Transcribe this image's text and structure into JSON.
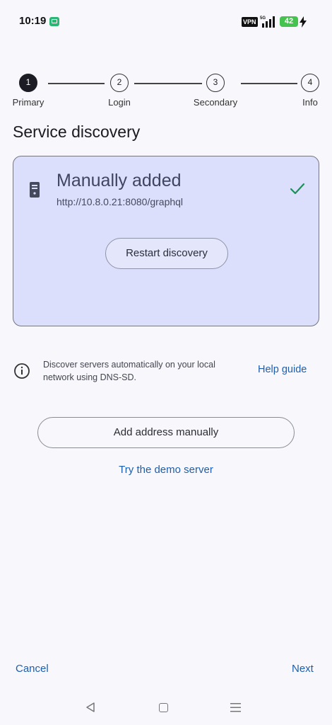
{
  "status_bar": {
    "time": "10:19",
    "app_icon": "screen-notification-icon",
    "vpn_label": "VPN",
    "network_label": "5G",
    "battery_level": "42",
    "charging_icon": "bolt-icon"
  },
  "stepper": {
    "steps": [
      {
        "number": "1",
        "label": "Primary",
        "active": true
      },
      {
        "number": "2",
        "label": "Login",
        "active": false
      },
      {
        "number": "3",
        "label": "Secondary",
        "active": false
      },
      {
        "number": "4",
        "label": "Info",
        "active": false
      }
    ]
  },
  "page": {
    "title": "Service discovery"
  },
  "server_card": {
    "icon": "server-icon",
    "name": "Manually added",
    "url": "http://10.8.0.21:8080/graphql",
    "selected_icon": "check-icon",
    "restart_label": "Restart discovery",
    "background_color": "#dcdffc"
  },
  "info": {
    "icon": "info-icon",
    "text": "Discover servers automatically on your local network using DNS-SD.",
    "help_label": "Help guide"
  },
  "actions": {
    "add_manual_label": "Add address manually",
    "demo_label": "Try the demo server"
  },
  "footer": {
    "cancel_label": "Cancel",
    "next_label": "Next"
  },
  "nav_bar": {
    "back_icon": "back-triangle-icon",
    "home_icon": "home-square-icon",
    "menu_icon": "menu-lines-icon"
  },
  "colors": {
    "accent_link": "#1d5fae",
    "check_green": "#1e8e5a",
    "active_step": "#1c1c24"
  }
}
